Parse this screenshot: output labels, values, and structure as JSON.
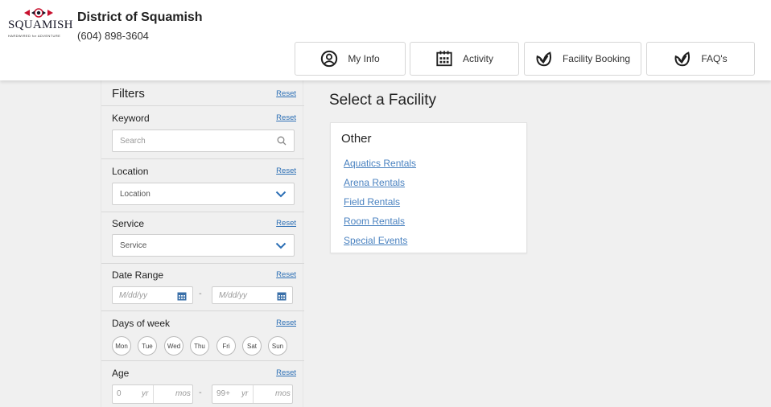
{
  "header": {
    "logo_word": "SQUAMISH",
    "logo_tagline": "HARDWIRED for ADVENTURE",
    "org_name": "District of Squamish",
    "phone": "(604) 898-3604",
    "nav": [
      {
        "label": "My Info",
        "icon": "user-circle-icon"
      },
      {
        "label": "Activity",
        "icon": "calendar-icon"
      },
      {
        "label": "Facility Booking",
        "icon": "leaf-check-icon"
      },
      {
        "label": "FAQ's",
        "icon": "leaf-check-icon"
      }
    ]
  },
  "filters": {
    "title": "Filters",
    "reset_label": "Reset",
    "keyword": {
      "label": "Keyword",
      "placeholder": "Search"
    },
    "location": {
      "label": "Location",
      "value": "Location"
    },
    "service": {
      "label": "Service",
      "value": "Service"
    },
    "date_range": {
      "label": "Date Range",
      "start_placeholder": "M/dd/yy",
      "end_placeholder": "M/dd/yy",
      "separator": "-"
    },
    "days_of_week": {
      "label": "Days of week",
      "days": [
        "Mon",
        "Tue",
        "Wed",
        "Thu",
        "Fri",
        "Sat",
        "Sun"
      ]
    },
    "age": {
      "label": "Age",
      "min_years": "0",
      "max_years": "99+",
      "year_unit": "yr",
      "month_unit": "mos",
      "separator": "-"
    }
  },
  "content": {
    "title": "Select a Facility",
    "card": {
      "title": "Other",
      "links": [
        "Aquatics Rentals",
        "Arena Rentals",
        "Field Rentals",
        "Room Rentals",
        "Special Events"
      ]
    }
  },
  "colors": {
    "link": "#4a82c0",
    "reset_link": "#2c6fb5",
    "icon_dark": "#1f1f1f",
    "background": "#f0f0f0",
    "calendar_icon": "#3a6fa8",
    "logo_red": "#c8102e"
  }
}
